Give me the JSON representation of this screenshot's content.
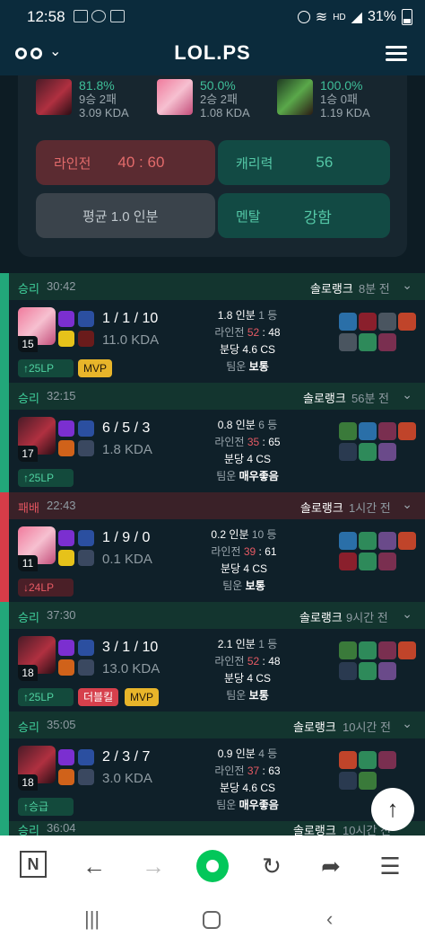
{
  "status_bar": {
    "time": "12:58",
    "battery": "31%"
  },
  "header": {
    "logo": "LOL.PS"
  },
  "summary": {
    "champions": [
      {
        "winrate": "81.8%",
        "record": "9승 2패",
        "kda": "3.09 KDA"
      },
      {
        "winrate": "50.0%",
        "record": "2승 2패",
        "kda": "1.08 KDA"
      },
      {
        "winrate": "100.0%",
        "record": "1승 0패",
        "kda": "1.19 KDA"
      }
    ],
    "laning_label": "라인전",
    "laning_value": "40 : 60",
    "carry_label": "캐리력",
    "carry_value": "56",
    "avg_label": "평균 1.0 인분",
    "mental_label": "멘탈",
    "mental_value": "강함"
  },
  "games": [
    {
      "result": "승리",
      "duration": "30:42",
      "queue": "솔로랭크",
      "ago": "8분 전",
      "level": "15",
      "kda": "1 / 1 / 10",
      "kda_ratio": "11.0 KDA",
      "lp": "↑25LP",
      "tags": [
        "MVP"
      ],
      "contrib": "1.8 인분",
      "rank": "1 등",
      "lane_label": "라인전",
      "lane_a": "52",
      "lane_b": "48",
      "cs": "분당 4.6 CS",
      "luck_label": "팀운",
      "luck": "보통"
    },
    {
      "result": "승리",
      "duration": "32:15",
      "queue": "솔로랭크",
      "ago": "56분 전",
      "level": "17",
      "kda": "6 / 5 / 3",
      "kda_ratio": "1.8 KDA",
      "lp": "↑25LP",
      "tags": [],
      "contrib": "0.8 인분",
      "rank": "6 등",
      "lane_label": "라인전",
      "lane_a": "35",
      "lane_b": "65",
      "cs": "분당 4 CS",
      "luck_label": "팀운",
      "luck": "매우좋음"
    },
    {
      "result": "패배",
      "duration": "22:43",
      "queue": "솔로랭크",
      "ago": "1시간 전",
      "level": "11",
      "kda": "1 / 9 / 0",
      "kda_ratio": "0.1 KDA",
      "lp": "↓24LP",
      "tags": [],
      "contrib": "0.2 인분",
      "rank": "10 등",
      "lane_label": "라인전",
      "lane_a": "39",
      "lane_b": "61",
      "cs": "분당 4 CS",
      "luck_label": "팀운",
      "luck": "보통"
    },
    {
      "result": "승리",
      "duration": "37:30",
      "queue": "솔로랭크",
      "ago": "9시간 전",
      "level": "18",
      "kda": "3 / 1 / 10",
      "kda_ratio": "13.0 KDA",
      "lp": "↑25LP",
      "tags": [
        "더블킬",
        "MVP"
      ],
      "contrib": "2.1 인분",
      "rank": "1 등",
      "lane_label": "라인전",
      "lane_a": "52",
      "lane_b": "48",
      "cs": "분당 4 CS",
      "luck_label": "팀운",
      "luck": "보통"
    },
    {
      "result": "승리",
      "duration": "35:05",
      "queue": "솔로랭크",
      "ago": "10시간 전",
      "level": "18",
      "kda": "2 / 3 / 7",
      "kda_ratio": "3.0 KDA",
      "lp": "↑승급",
      "tags": [],
      "contrib": "0.9 인분",
      "rank": "4 등",
      "lane_label": "라인전",
      "lane_a": "37",
      "lane_b": "63",
      "cs": "분당 4.6 CS",
      "luck_label": "팀운",
      "luck": "매우좋음"
    },
    {
      "result": "승리",
      "duration": "36:04",
      "queue": "솔로랭크",
      "ago": "10시간 전"
    }
  ]
}
